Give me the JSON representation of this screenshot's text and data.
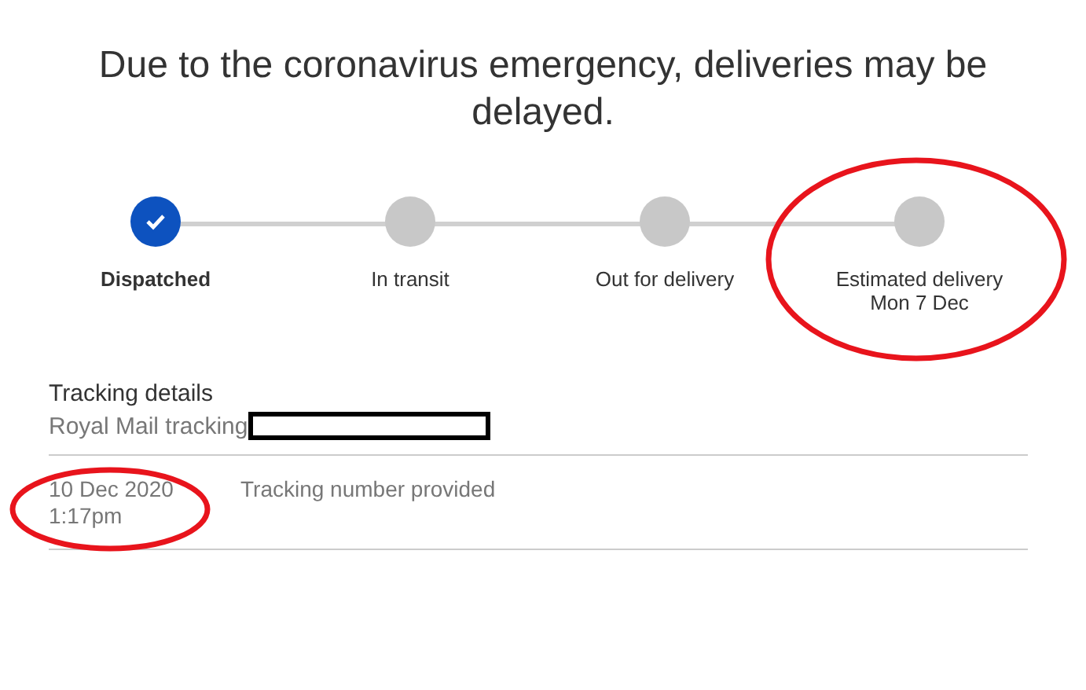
{
  "notice": "Due to the coronavirus emergency, deliveries may be delayed.",
  "steps": [
    {
      "label": "Dispatched",
      "done": true
    },
    {
      "label": "In transit",
      "done": false
    },
    {
      "label": "Out for delivery",
      "done": false
    },
    {
      "label": "Estimated delivery",
      "sublabel": "Mon 7 Dec",
      "done": false
    }
  ],
  "tracking": {
    "title": "Tracking details",
    "carrier": "Royal Mail tracking"
  },
  "events": [
    {
      "date": "10 Dec 2020",
      "time": "1:17pm",
      "description": "Tracking number provided"
    }
  ]
}
